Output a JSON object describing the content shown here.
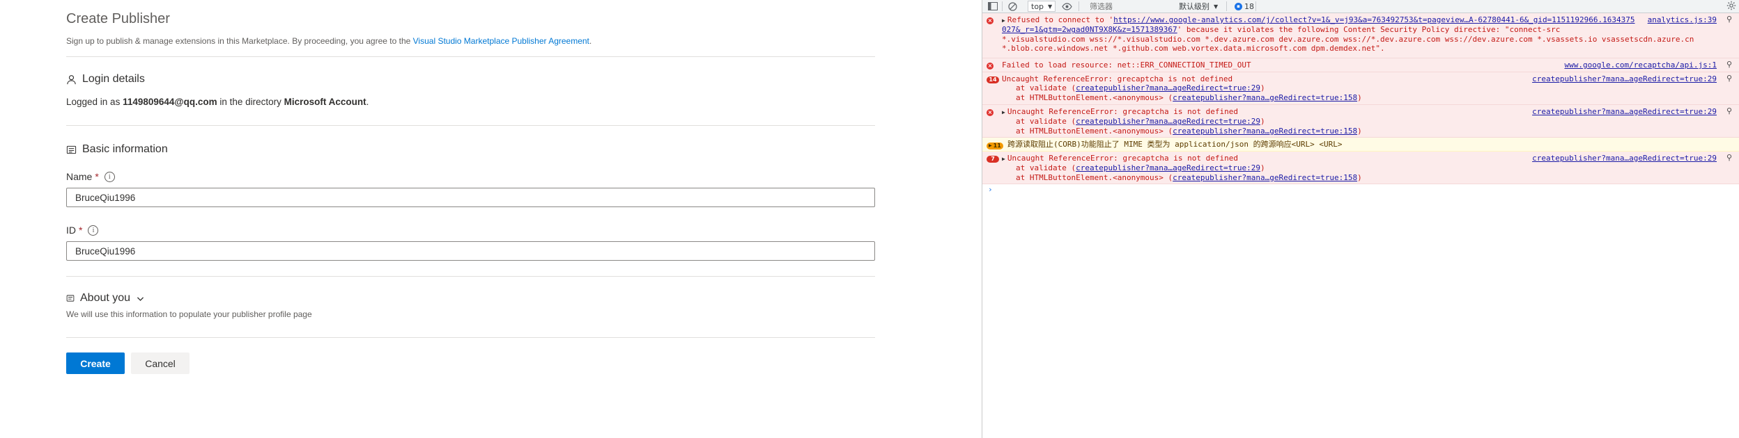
{
  "page": {
    "title": "Create Publisher",
    "subtitle_pre": "Sign up to publish & manage extensions in this Marketplace. By proceeding, you agree to the ",
    "subtitle_link": "Visual Studio Marketplace Publisher Agreement",
    "subtitle_post": "."
  },
  "login": {
    "heading": "Login details",
    "text_pre": "Logged in as ",
    "email": "1149809644@qq.com",
    "text_mid": " in the directory ",
    "directory": "Microsoft Account",
    "text_post": "."
  },
  "basic": {
    "heading": "Basic information",
    "name_label": "Name",
    "name_required": "*",
    "name_value": "BruceQiu1996",
    "id_label": "ID",
    "id_required": "*",
    "id_value": "BruceQiu1996"
  },
  "about": {
    "heading": "About you",
    "description": "We will use this information to populate your publisher profile page"
  },
  "actions": {
    "create": "Create",
    "cancel": "Cancel"
  },
  "devtools": {
    "context": "top",
    "filter_placeholder": "筛选器",
    "level": "默认级别",
    "message_count": "18",
    "messages": [
      {
        "line1_pre": "Refused to connect to '",
        "line1_link": "https://www.google-analytics.com/j/collect?v=1&_v=j93&a=763492753&t=pageview…A-62780441-6&_gid=1151192966.1634375",
        "line2_link": "027&_r=1&gtm=2wgad0NT9X8K&z=1571389367",
        "line2_post": "' because it violates the following Content Security Policy directive: \"connect-src",
        "line3": "*.visualstudio.com wss://*.visualstudio.com *.dev.azure.com dev.azure.com wss://*.dev.azure.com wss://dev.azure.com *.vsassets.io vsassetscdn.azure.cn",
        "line4": "*.blob.core.windows.net *.github.com web.vortex.data.microsoft.com dpm.demdex.net\".",
        "source": "analytics.js:39"
      },
      {
        "text": "Failed to load resource: net::ERR_CONNECTION_TIMED_OUT",
        "source": "www.google.com/recaptcha/api.js:1"
      },
      {
        "count": "14",
        "text": "Uncaught ReferenceError: grecaptcha is not defined",
        "trace1_pre": "at validate (",
        "trace1_link": "createpublisher?mana…ageRedirect=true:29",
        "trace1_post": ")",
        "trace2_pre": "at HTMLButtonElement.<anonymous> (",
        "trace2_link": "createpublisher?mana…geRedirect=true:158",
        "trace2_post": ")",
        "source": "createpublisher?mana…ageRedirect=true:29"
      },
      {
        "text": "Uncaught ReferenceError: grecaptcha is not defined",
        "trace1_pre": "at validate (",
        "trace1_link": "createpublisher?mana…ageRedirect=true:29",
        "trace1_post": ")",
        "trace2_pre": "at HTMLButtonElement.<anonymous> (",
        "trace2_link": "createpublisher?mana…geRedirect=true:158",
        "trace2_post": ")",
        "source": "createpublisher?mana…ageRedirect=true:29"
      },
      {
        "count": "11",
        "text": "跨源读取阻止(CORB)功能阻止了 MIME 类型为 application/json 的跨源响应<URL> <URL>"
      },
      {
        "count": "7",
        "text": "Uncaught ReferenceError: grecaptcha is not defined",
        "trace1_pre": "at validate (",
        "trace1_link": "createpublisher?mana…ageRedirect=true:29",
        "trace1_post": ")",
        "trace2_pre": "at HTMLButtonElement.<anonymous> (",
        "trace2_link": "createpublisher?mana…geRedirect=true:158",
        "trace2_post": ")",
        "source": "createpublisher?mana…ageRedirect=true:29"
      }
    ],
    "prompt": "›"
  }
}
